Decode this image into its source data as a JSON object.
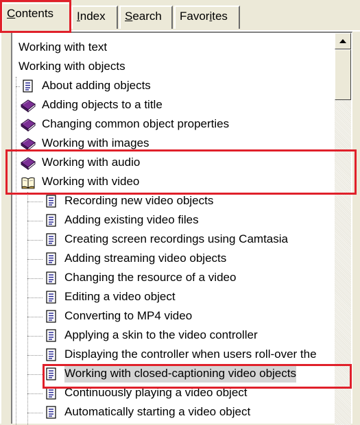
{
  "tabs": [
    {
      "label": "Contents",
      "accel": "C",
      "rest": "ontents",
      "active": true
    },
    {
      "label": "Index",
      "accel": "I",
      "rest": "ndex",
      "active": false
    },
    {
      "label": "Search",
      "accel": "S",
      "rest": "earch",
      "active": false
    },
    {
      "label": "Favorites",
      "pre": "Favor",
      "accel": "i",
      "rest": "tes",
      "active": false
    }
  ],
  "tree": {
    "items": [
      {
        "label": "Working with text",
        "icon": "none"
      },
      {
        "label": "Working with objects",
        "icon": "none"
      },
      {
        "label": "About adding objects",
        "icon": "page-icon"
      },
      {
        "label": "Adding objects to a title",
        "icon": "closed-book-icon"
      },
      {
        "label": "Changing common object properties",
        "icon": "closed-book-icon"
      },
      {
        "label": "Working with images",
        "icon": "closed-book-icon"
      },
      {
        "label": "Working with audio",
        "icon": "closed-book-icon"
      },
      {
        "label": "Working with video",
        "icon": "open-book-icon"
      },
      {
        "label": "Recording new video objects",
        "icon": "page-icon"
      },
      {
        "label": "Adding existing video files",
        "icon": "page-icon"
      },
      {
        "label": "Creating screen recordings using Camtasia",
        "icon": "page-icon"
      },
      {
        "label": "Adding streaming video objects",
        "icon": "page-icon"
      },
      {
        "label": "Changing the resource of a video",
        "icon": "page-icon"
      },
      {
        "label": "Editing a video object",
        "icon": "page-icon"
      },
      {
        "label": "Converting to MP4 video",
        "icon": "page-icon"
      },
      {
        "label": "Applying a skin to the video controller",
        "icon": "page-icon"
      },
      {
        "label": "Displaying the controller when users roll-over the",
        "icon": "page-icon"
      },
      {
        "label": "Working with closed-captioning video objects",
        "icon": "page-icon",
        "selected": true
      },
      {
        "label": "Continuously playing a video object",
        "icon": "page-icon"
      },
      {
        "label": "Automatically starting a video object",
        "icon": "page-icon"
      }
    ]
  },
  "colors": {
    "highlight": "#e0202a",
    "book": "#6a2a86",
    "selection": "#d4d4d4"
  }
}
